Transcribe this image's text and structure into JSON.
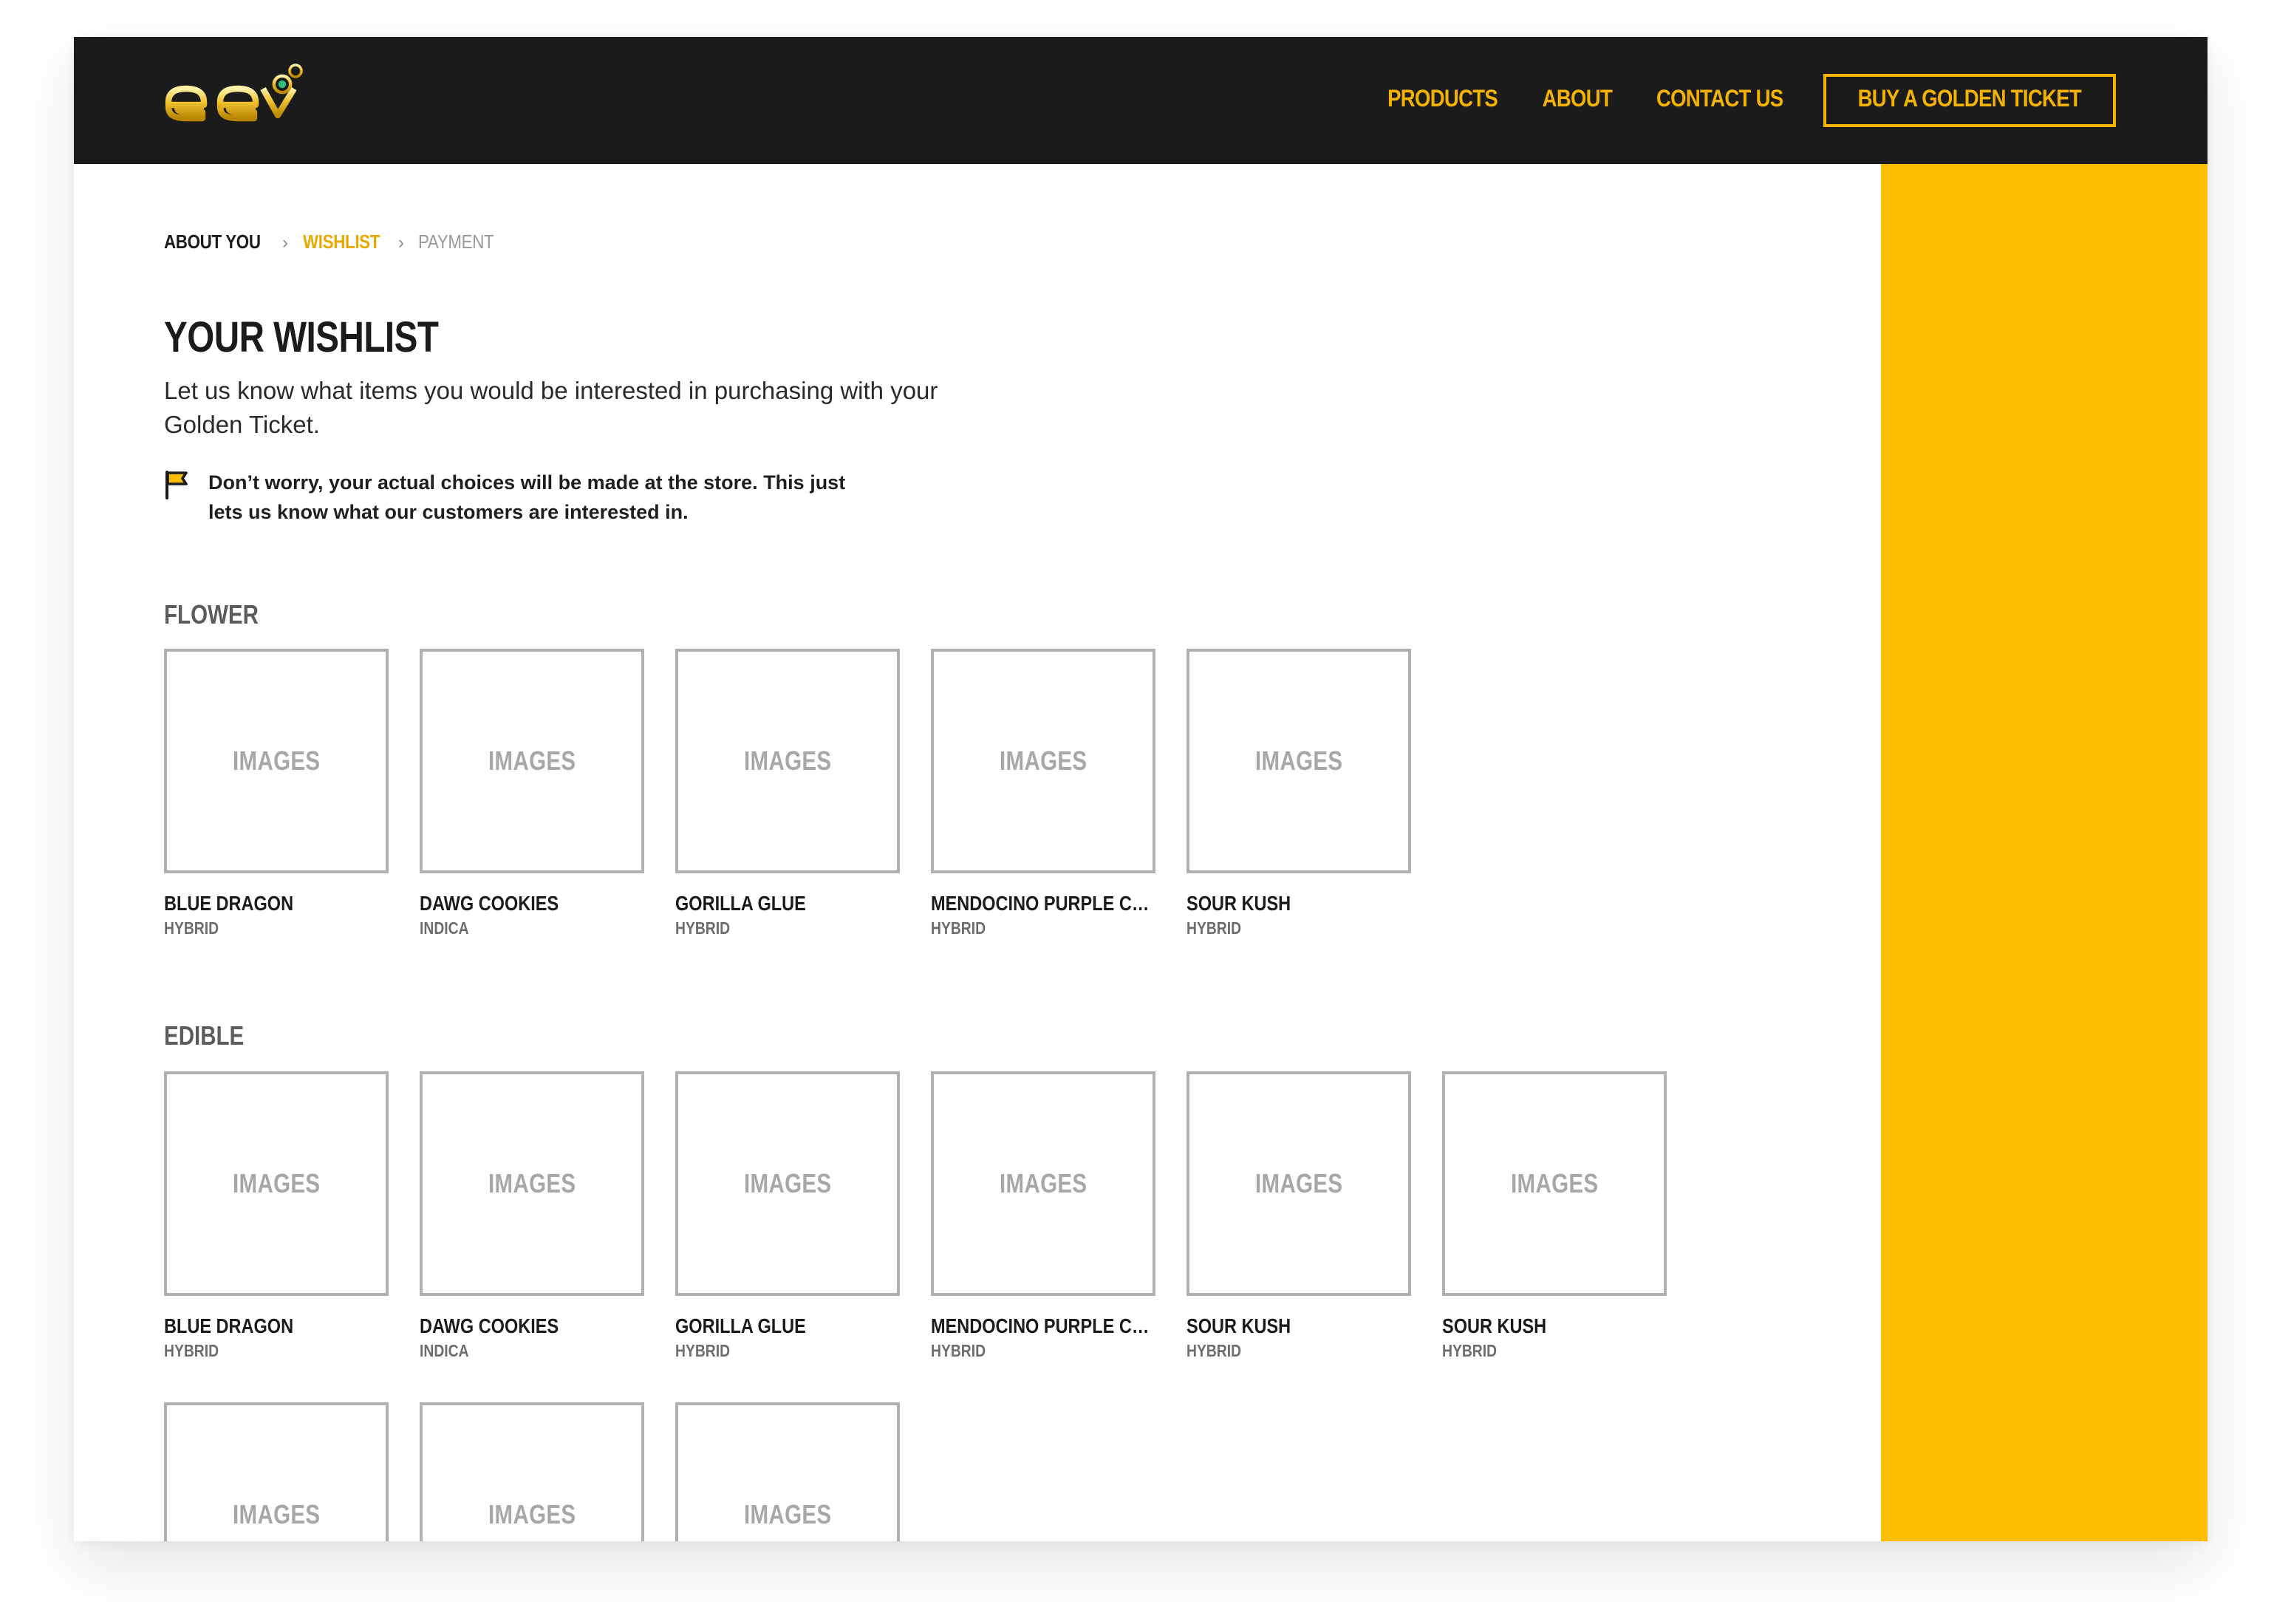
{
  "header": {
    "logo_text": "elev",
    "nav": {
      "products": "PRODUCTS",
      "about": "ABOUT",
      "contact": "CONTACT US",
      "cta": "BUY A GOLDEN TICKET"
    }
  },
  "breadcrumb": {
    "step1": "ABOUT YOU",
    "step2": "WISHLIST",
    "step3": "PAYMENT",
    "separator": "›"
  },
  "page": {
    "title": "YOUR WISHLIST",
    "intro": "Let us know what items you would be interested in purchasing with your Golden Ticket.",
    "note": "Don’t worry, your actual choices will be made at the store. This just lets us know what our customers are interested in.",
    "note_icon": "flag-icon"
  },
  "image_placeholder": "IMAGES",
  "sections": {
    "flower": {
      "title": "FLOWER",
      "items": [
        {
          "name": "BLUE DRAGON",
          "type": "HYBRID"
        },
        {
          "name": "DAWG COOKIES",
          "type": "INDICA"
        },
        {
          "name": "GORILLA GLUE",
          "type": "HYBRID"
        },
        {
          "name": "MENDOCINO PURPLE CH...",
          "type": "HYBRID"
        },
        {
          "name": "SOUR KUSH",
          "type": "HYBRID"
        }
      ]
    },
    "edible": {
      "title": "EDIBLE",
      "items": [
        {
          "name": "BLUE DRAGON",
          "type": "HYBRID"
        },
        {
          "name": "DAWG COOKIES",
          "type": "INDICA"
        },
        {
          "name": "GORILLA GLUE",
          "type": "HYBRID"
        },
        {
          "name": "MENDOCINO PURPLE CH...",
          "type": "HYBRID"
        },
        {
          "name": "SOUR KUSH",
          "type": "HYBRID"
        },
        {
          "name": "SOUR KUSH",
          "type": "HYBRID"
        }
      ]
    }
  },
  "colors": {
    "header_bg": "#1b1b1b",
    "accent_gold": "#f4b300",
    "side_panel": "#fdbd00",
    "placeholder_border": "#b1b1b1"
  }
}
